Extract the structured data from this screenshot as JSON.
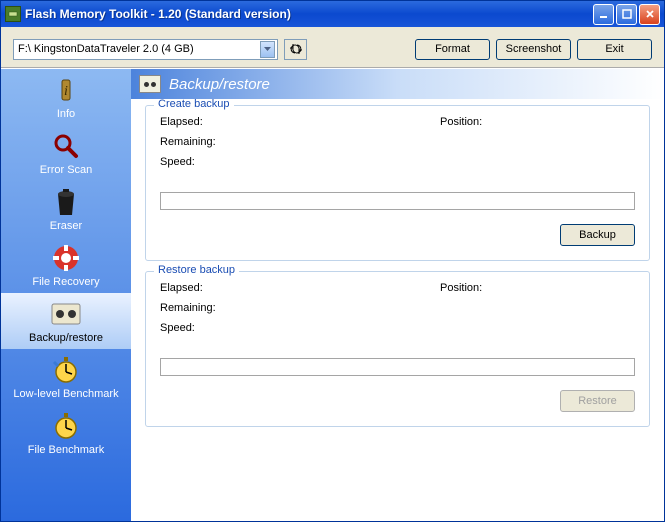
{
  "window": {
    "title": "Flash Memory Toolkit - 1.20 (Standard version)"
  },
  "toolbar": {
    "drive_selected": "F:\\ KingstonDataTraveler 2.0 (4 GB)",
    "format_label": "Format",
    "screenshot_label": "Screenshot",
    "exit_label": "Exit"
  },
  "sidebar": {
    "items": [
      {
        "label": "Info"
      },
      {
        "label": "Error Scan"
      },
      {
        "label": "Eraser"
      },
      {
        "label": "File Recovery"
      },
      {
        "label": "Backup/restore"
      },
      {
        "label": "Low-level Benchmark"
      },
      {
        "label": "File Benchmark"
      }
    ]
  },
  "main": {
    "header_title": "Backup/restore",
    "create": {
      "legend": "Create backup",
      "elapsed_label": "Elapsed:",
      "remaining_label": "Remaining:",
      "speed_label": "Speed:",
      "position_label": "Position:",
      "button_label": "Backup"
    },
    "restore": {
      "legend": "Restore backup",
      "elapsed_label": "Elapsed:",
      "remaining_label": "Remaining:",
      "speed_label": "Speed:",
      "position_label": "Position:",
      "button_label": "Restore"
    }
  }
}
